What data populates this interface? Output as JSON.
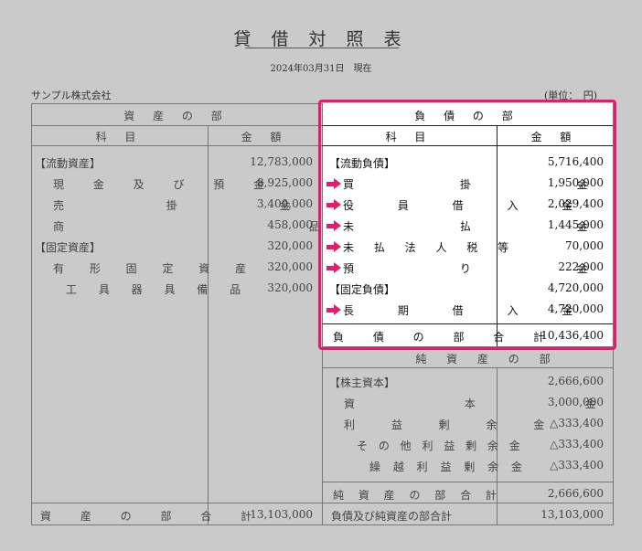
{
  "header": {
    "title": "貸 借 対 照 表",
    "date": "2024年03月31日　現在",
    "company": "サンプル株式会社",
    "unit": "(単位：　円)"
  },
  "assets": {
    "section_title": "資 産 の 部",
    "col_item": "科 目",
    "col_amount": "金 額",
    "rows": [
      {
        "label": "【流動資産】",
        "amount": "12,783,000"
      },
      {
        "label": "現 金 及 び 預 金",
        "amount": "8,925,000"
      },
      {
        "label": "売 掛 金",
        "amount": "3,400,000"
      },
      {
        "label": "商 品",
        "amount": "458,000"
      },
      {
        "label": "【固定資産】",
        "amount": "320,000"
      },
      {
        "label": "有 形 固 定 資 産",
        "amount": "320,000"
      },
      {
        "label": "工 具 器 具 備 品",
        "amount": "320,000"
      }
    ],
    "total_label": "資 産 の 部 合 計",
    "total_amount": "13,103,000"
  },
  "liabilities": {
    "section_title": "負 債 の 部",
    "col_item": "科 目",
    "col_amount": "金 額",
    "rows": [
      {
        "label": "【流動負債】",
        "amount": "5,716,400",
        "arrow": false
      },
      {
        "label": "買 掛 金",
        "amount": "1,950,000",
        "arrow": true
      },
      {
        "label": "役 員 借 入 金",
        "amount": "2,029,400",
        "arrow": true
      },
      {
        "label": "未 払 金",
        "amount": "1,445,000",
        "arrow": true
      },
      {
        "label": "未 払 法 人 税 等",
        "amount": "70,000",
        "arrow": true
      },
      {
        "label": "預 り 金",
        "amount": "222,000",
        "arrow": true
      },
      {
        "label": "【固定負債】",
        "amount": "4,720,000",
        "arrow": false
      },
      {
        "label": "長 期 借 入 金",
        "amount": "4,720,000",
        "arrow": true
      }
    ],
    "total_label": "負 債 の 部 合 計",
    "total_amount": "10,436,400"
  },
  "net_assets": {
    "section_title": "純 資 産 の 部",
    "rows": [
      {
        "label": "【株主資本】",
        "amount": "2,666,600"
      },
      {
        "label": "資 本 金",
        "amount": "3,000,000"
      },
      {
        "label": "利 益 剰 余 金",
        "amount": "△333,400"
      },
      {
        "label": "そ の 他 利 益 剰 余 金",
        "amount": "△333,400"
      },
      {
        "label": "繰 越 利 益 剰 余 金",
        "amount": "△333,400"
      }
    ],
    "total_label": "純 資 産 の 部 合 計",
    "total_amount": "2,666,600",
    "grand_total_label": "負債及び純資産の部合計",
    "grand_total_amount": "13,103,000"
  },
  "colors": {
    "highlight": "#e8196e",
    "background": "#cacaca"
  }
}
